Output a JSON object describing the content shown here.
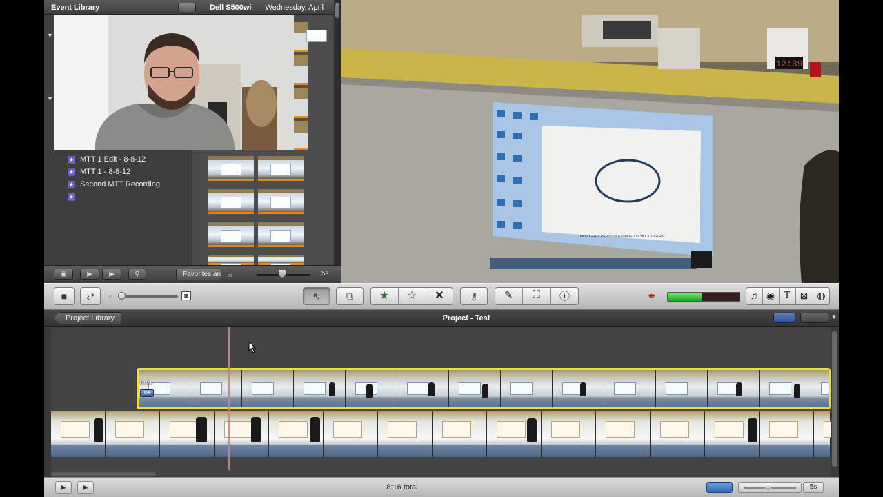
{
  "event_library": {
    "title": "Event Library",
    "camera_name": "Dell S500wi",
    "date_label": "Wednesday, April",
    "events": [
      {
        "label": "MTT 1 Edit - 8-8-12"
      },
      {
        "label": "MTT 1 - 8-8-12"
      },
      {
        "label": "Second MTT Recording"
      },
      {
        "label": ""
      }
    ],
    "filter_label": "Favorites an",
    "duration_label": "5s"
  },
  "viewer": {
    "clock_display": "12:39",
    "screen_caption": "MONTEREY PENINSULA UNIFIED SCHOOL DISTRICT"
  },
  "project": {
    "library_button_label": "Project Library",
    "title": "Project - Test",
    "clip_duration": "8:01"
  },
  "bottom_bar": {
    "total_time": "8:16 total",
    "duration_label": "5s"
  },
  "colors": {
    "accent": "#f0dd3b",
    "selection_blue": "#3466b2",
    "playhead": "#e07a7a",
    "thumbnail_strip": "#e0891c"
  },
  "icons": {
    "toolbar": [
      "camera-icon",
      "swap-icon",
      "small-thumb-icon",
      "large-thumb-icon",
      "arrow-pointer-icon",
      "add-selection-icon",
      "favorite-star-icon",
      "unmark-star-icon",
      "reject-x-icon",
      "key-icon",
      "eyedropper-icon",
      "crop-icon",
      "info-icon",
      "voiceover-icon",
      "music-icon",
      "photo-icon",
      "title-icon",
      "transition-icon",
      "map-icon"
    ]
  }
}
